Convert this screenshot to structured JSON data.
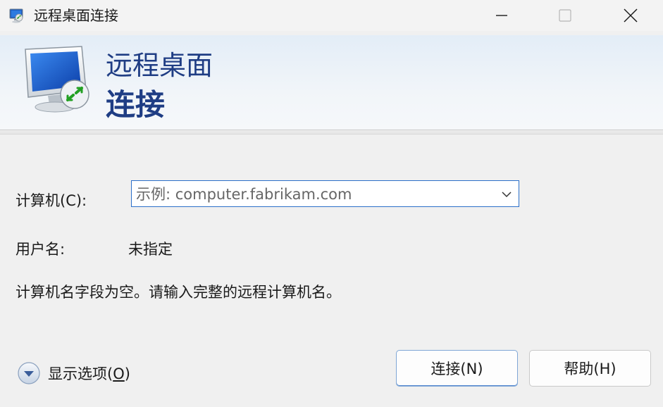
{
  "window": {
    "title": "远程桌面连接",
    "icon": "remote-desktop-icon"
  },
  "title_controls": {
    "minimize": "minimize-icon",
    "maximize": "maximize-icon",
    "close": "close-icon"
  },
  "banner": {
    "line1": "远程桌面",
    "line2": "连接",
    "icon": "monitor-icon"
  },
  "form": {
    "computer_label": "计算机(C):",
    "computer_placeholder": "示例: computer.fabrikam.com",
    "computer_value": "",
    "username_label": "用户名:",
    "username_value": "未指定",
    "message": "计算机名字段为空。请输入完整的远程计算机名。"
  },
  "footer": {
    "options_label_prefix": "显示选项(",
    "options_label_key": "O",
    "options_label_suffix": ")",
    "connect_label": "连接(N)",
    "help_label": "帮助(H)"
  },
  "colors": {
    "banner_text": "#1f3d84",
    "focus_border": "#2b6fc9",
    "window_bg": "#f0f0f0"
  }
}
